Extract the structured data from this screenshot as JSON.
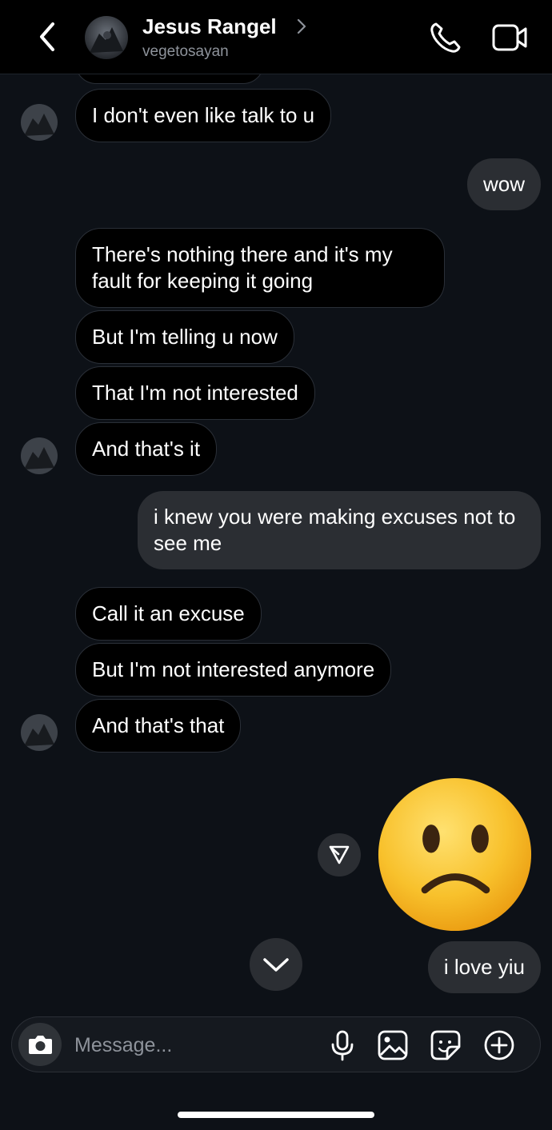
{
  "header": {
    "name": "Jesus Rangel",
    "username": "vegetosayan"
  },
  "messages": [
    {
      "side": "in",
      "text": "I don't even like talk to u"
    },
    {
      "side": "out",
      "text": "wow"
    },
    {
      "side": "in",
      "text": "There's nothing there and it's my fault for keeping it going"
    },
    {
      "side": "in",
      "text": "But I'm telling u now"
    },
    {
      "side": "in",
      "text": "That I'm not interested"
    },
    {
      "side": "in",
      "text": "And that's it"
    },
    {
      "side": "out",
      "text": "i knew you were making excuses not to see me"
    },
    {
      "side": "in",
      "text": "Call it an excuse"
    },
    {
      "side": "in",
      "text": "But I'm not interested anymore"
    },
    {
      "side": "in",
      "text": "And that's that"
    },
    {
      "side": "out",
      "text": "i love yiu"
    }
  ],
  "sent_sticker": "slightly-frowning-face-emoji",
  "composer": {
    "placeholder": "Message..."
  },
  "icons": [
    "back-icon",
    "chevron-right-icon",
    "phone-icon",
    "video-camera-icon",
    "send-icon",
    "chevron-down-icon",
    "camera-icon",
    "microphone-icon",
    "gallery-icon",
    "sticker-icon",
    "plus-icon"
  ],
  "colors": {
    "background": "#0d1117",
    "header": "#000000",
    "incoming_bubble": "#000000",
    "outgoing_bubble": "#2b2e33",
    "secondary_text": "#8e939b",
    "emoji_yellow": "#f5b41f"
  }
}
